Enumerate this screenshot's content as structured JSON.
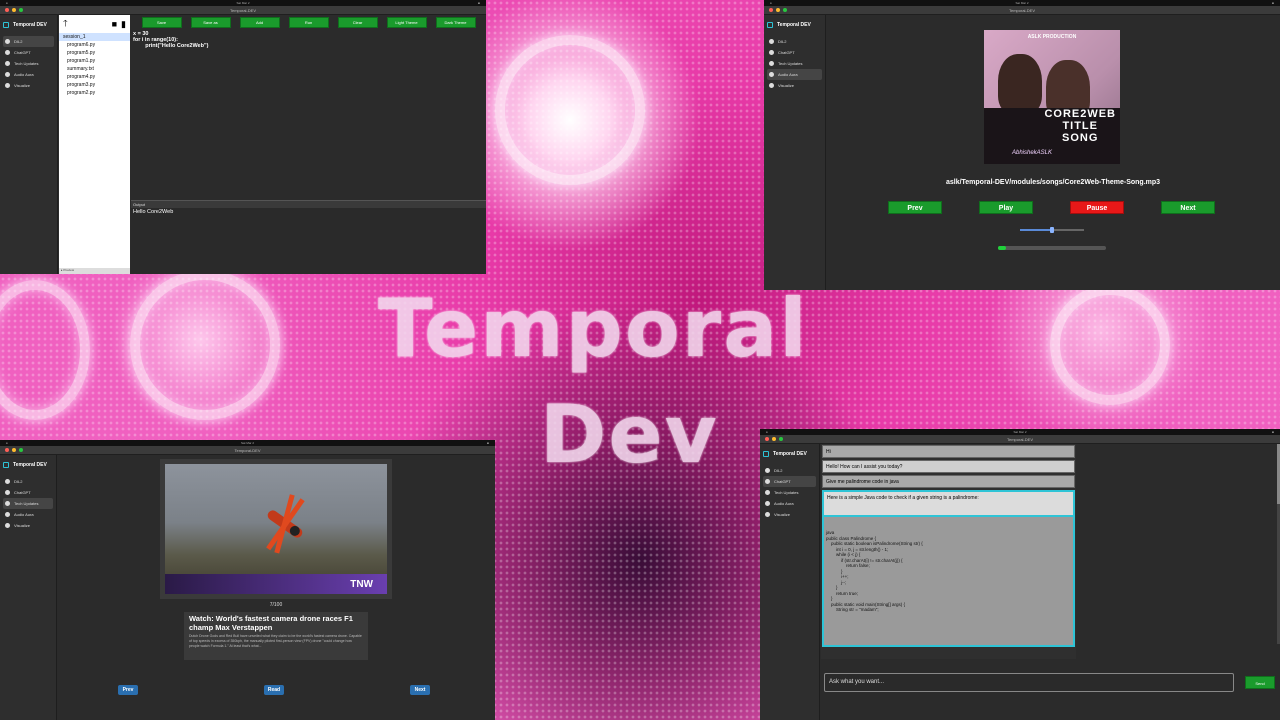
{
  "backdrop": {
    "line1": "Temporal",
    "line2": "Dev"
  },
  "common": {
    "window_title": "Temporal-DEV",
    "app_name": "Temporal DEV",
    "nav": [
      "DIL2",
      "ChatGPT",
      "Tech Updates",
      "Audio Aura",
      "Visualize"
    ]
  },
  "editor": {
    "toolbar": [
      "Save",
      "Save as",
      "Add",
      "Run",
      "Clear",
      "Light Theme",
      "Dark Theme"
    ],
    "files": [
      "session_1",
      "program6.py",
      "program5.py",
      "program1.py",
      "summary.txt",
      "program4.py",
      "program3.py",
      "program2.py"
    ],
    "code": [
      "x = 30",
      "for i in range(10):",
      "        print(\"Hello Core2Web\")"
    ],
    "output_label": "Output",
    "output_text": "Hello Core2Web",
    "footer": "▸ Preview"
  },
  "audio": {
    "cover": {
      "top": "ASLK PRODUCTION",
      "l1": "CORE2WEB",
      "l2": "TITLE",
      "l3": "SONG",
      "sig": "AbhishekASLK"
    },
    "path": "aslk/Temporal-DEV/modules/songs/Core2Web-Theme-Song.mp3",
    "buttons": [
      "Prev",
      "Play",
      "Pause",
      "Next"
    ],
    "volume": 0.5,
    "progress": 0.07
  },
  "news": {
    "counter": "7/100",
    "image_brand": "TNW",
    "title": "Watch: World's fastest camera drone races F1 champ Max Verstappen",
    "body": "Dutch Drone Gods and Red Bull have unveiled what they claim to be the world's fastest camera drone.  Capable of top speeds in excess of 350kph, the manually piloted first-person view (FPV) drone \"could change how people watch Formula 1.\" At least that's what...",
    "buttons": [
      "Prev",
      "Read",
      "Next"
    ]
  },
  "chat": {
    "messages": [
      {
        "text": "Hi",
        "role": "user"
      },
      {
        "text": "Hello! How can I assist you today?",
        "role": "bot"
      },
      {
        "text": "Give me palindrome code in java",
        "role": "user"
      },
      {
        "text": "Here is a simple Java code to check if a given string is a palindrome:",
        "role": "bot"
      }
    ],
    "code": [
      "java",
      "public class Palindrome {",
      "    public static boolean isPalindrome(String str) {",
      "        int i = 0, j = str.length() - 1;",
      "",
      "        while (i < j) {",
      "            if (str.charAt(i) != str.charAt(j)) {",
      "                return false;",
      "            }",
      "            i++;",
      "            j--;",
      "        }",
      "",
      "        return true;",
      "    }",
      "",
      "    public static void main(String[] args) {",
      "        String str = \"madam\";"
    ],
    "input_placeholder": "Ask what you want...",
    "send_label": "Send"
  },
  "colors": {
    "green": "#1a9b2c",
    "red": "#e81818",
    "blue": "#2a6fb0",
    "accent": "#2ec4d6"
  }
}
